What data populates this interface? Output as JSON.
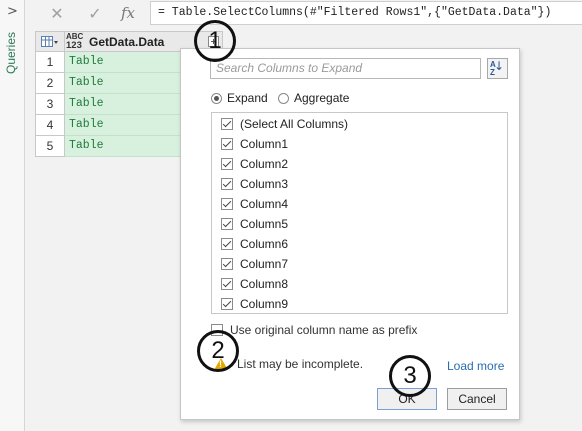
{
  "rail": {
    "chevron": ">",
    "label": "Queries"
  },
  "formula_bar": {
    "cancel_glyph": "✕",
    "confirm_glyph": "✓",
    "fx_label": "fx",
    "formula": "= Table.SelectColumns(#\"Filtered Rows1\",{\"GetData.Data\"})"
  },
  "grid": {
    "type_icon_top": "ABC",
    "type_icon_bottom": "123",
    "column_header": "GetData.Data",
    "rows": [
      {
        "num": "1",
        "value": "Table"
      },
      {
        "num": "2",
        "value": "Table"
      },
      {
        "num": "3",
        "value": "Table"
      },
      {
        "num": "4",
        "value": "Table"
      },
      {
        "num": "5",
        "value": "Table"
      }
    ]
  },
  "expand_panel": {
    "search_placeholder": "Search Columns to Expand",
    "sort_label_top": "A",
    "sort_label_bottom": "Z",
    "sort_arrow": "↓",
    "mode_options": [
      {
        "label": "Expand",
        "selected": true
      },
      {
        "label": "Aggregate",
        "selected": false
      }
    ],
    "columns": [
      {
        "label": "(Select All Columns)",
        "checked": true
      },
      {
        "label": "Column1",
        "checked": true
      },
      {
        "label": "Column2",
        "checked": true
      },
      {
        "label": "Column3",
        "checked": true
      },
      {
        "label": "Column4",
        "checked": true
      },
      {
        "label": "Column5",
        "checked": true
      },
      {
        "label": "Column6",
        "checked": true
      },
      {
        "label": "Column7",
        "checked": true
      },
      {
        "label": "Column8",
        "checked": true
      },
      {
        "label": "Column9",
        "checked": true
      }
    ],
    "prefix_label": "Use original column name as prefix",
    "prefix_checked": false,
    "warning_text": "List may be incomplete.",
    "load_more": "Load more",
    "ok_label": "OK",
    "cancel_label": "Cancel"
  },
  "callouts": [
    "1",
    "2",
    "3"
  ],
  "colors": {
    "cell_fill": "#d8f0de",
    "cell_text": "#207a3c",
    "link": "#2b6cb0",
    "queries_label": "#2f7a55"
  }
}
